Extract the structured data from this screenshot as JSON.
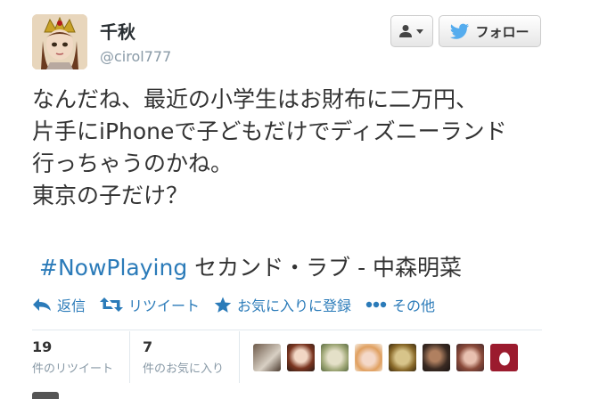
{
  "user": {
    "display_name": "千秋",
    "handle": "@cirol777"
  },
  "follow_button": {
    "label": "フォロー"
  },
  "tweet": {
    "text": "なんだね、最近の小学生はお財布に二万円、\n片手にiPhoneで子どもだけでディズニーランド\n行っちゃうのかね。\n東京の子だけ？",
    "hashtag": "#NowPlaying",
    "song": "セカンド・ラブ - 中森明菜"
  },
  "actions": [
    {
      "label": "返信",
      "icon": "reply-icon"
    },
    {
      "label": "リツイート",
      "icon": "retweet-icon"
    },
    {
      "label": "お気に入りに登録",
      "icon": "star-icon"
    },
    {
      "label": "その他",
      "icon": "more-icon"
    }
  ],
  "stats": {
    "retweets": {
      "count": "19",
      "label": "件のリツイート"
    },
    "favorites": {
      "count": "7",
      "label": "件のお気に入り"
    }
  },
  "colors": {
    "link": "#2b7bb9",
    "twitter_blue": "#55acee",
    "muted": "#8899a6"
  }
}
